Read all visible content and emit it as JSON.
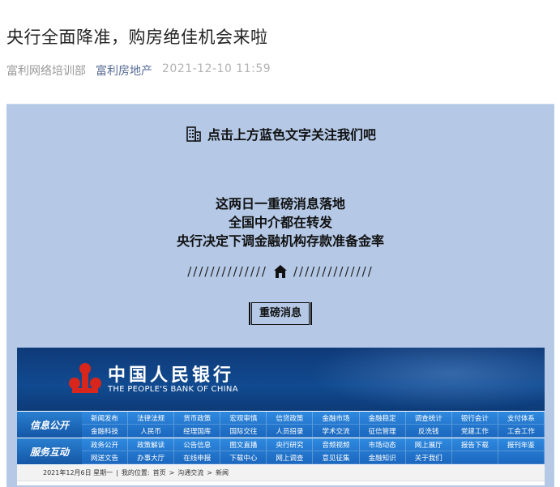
{
  "article": {
    "title": "央行全面降准，购房绝佳机会来啦",
    "author": "富利网络培训部",
    "account": "富利房地产",
    "date": "2021-12-10 11:59"
  },
  "card": {
    "follow_text": "点击上方蓝色文字关注我们吧",
    "headline": [
      "这两日一重磅消息落地",
      "全国中介都在转发",
      "央行决定下调金融机构存款准备金率"
    ],
    "divider_left": "//////////////",
    "divider_right": "//////////////",
    "pill_label": "重磅消息",
    "background_color": "#b5c9e7"
  },
  "pboc": {
    "name_cn": "中国人民银行",
    "name_en": "THE PEOPLE'S BANK OF CHINA",
    "nav1_label": "信息公开",
    "nav1_items": [
      "新闻发布",
      "法律法规",
      "货币政策",
      "宏观审慎",
      "信贷政策",
      "金融市场",
      "金融稳定",
      "调查统计",
      "银行会计",
      "支付体系",
      "金融科技",
      "人民币",
      "经理国库",
      "国际交往",
      "人员招录",
      "学术交流",
      "征信管理",
      "反洗钱",
      "党建工作",
      "工会工作"
    ],
    "nav2_label": "服务互动",
    "nav2_items": [
      "政务公开",
      "政策解读",
      "公告信息",
      "图文直播",
      "央行研究",
      "音频视频",
      "市场动态",
      "网上展厅",
      "报告下载",
      "报刊年鉴",
      "网送文告",
      "办事大厅",
      "在线申报",
      "下载中心",
      "网上调查",
      "意见征集",
      "金融知识",
      "关于我们",
      "",
      ""
    ],
    "breadcrumb": {
      "date": "2021年12月6日 星期一",
      "sep": "|",
      "location_label": "我的位置:",
      "home": "首页",
      "arrow": ">",
      "section": "沟通交流",
      "arrow2": ">",
      "current": "新闻"
    },
    "brand_color": "#114a90"
  }
}
